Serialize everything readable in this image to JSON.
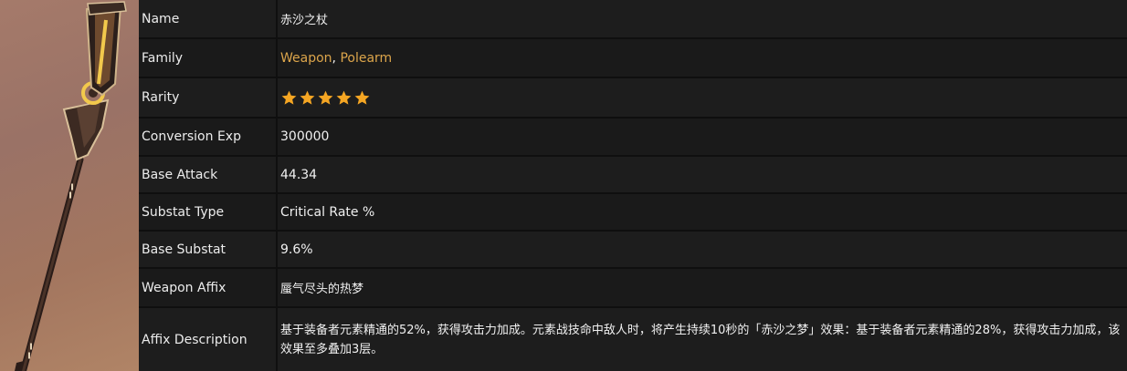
{
  "weapon": {
    "image_alt": "赤沙之杖 polearm image"
  },
  "rows": {
    "name": {
      "label": "Name",
      "value": "赤沙之杖"
    },
    "family": {
      "label": "Family",
      "links": [
        "Weapon",
        "Polearm"
      ],
      "separator": ","
    },
    "rarity": {
      "label": "Rarity",
      "stars": 5,
      "star_color": "#f5a623"
    },
    "conversion_exp": {
      "label": "Conversion Exp",
      "value": "300000"
    },
    "base_attack": {
      "label": "Base Attack",
      "value": "44.34"
    },
    "substat_type": {
      "label": "Substat Type",
      "value": "Critical Rate %"
    },
    "base_substat": {
      "label": "Base Substat",
      "value": "9.6%"
    },
    "weapon_affix": {
      "label": "Weapon Affix",
      "value": "蜃气尽头的热梦"
    },
    "affix_description": {
      "label": "Affix Description",
      "value": "基于装备者元素精通的52%，获得攻击力加成。元素战技命中敌人时，将产生持续10秒的「赤沙之梦」效果：基于装备者元素精通的28%，获得攻击力加成，该效果至多叠加3层。"
    }
  },
  "colors": {
    "accent_link": "#dca54b",
    "cell_bg": "#1d1d1d",
    "border": "#0f0f0f"
  }
}
